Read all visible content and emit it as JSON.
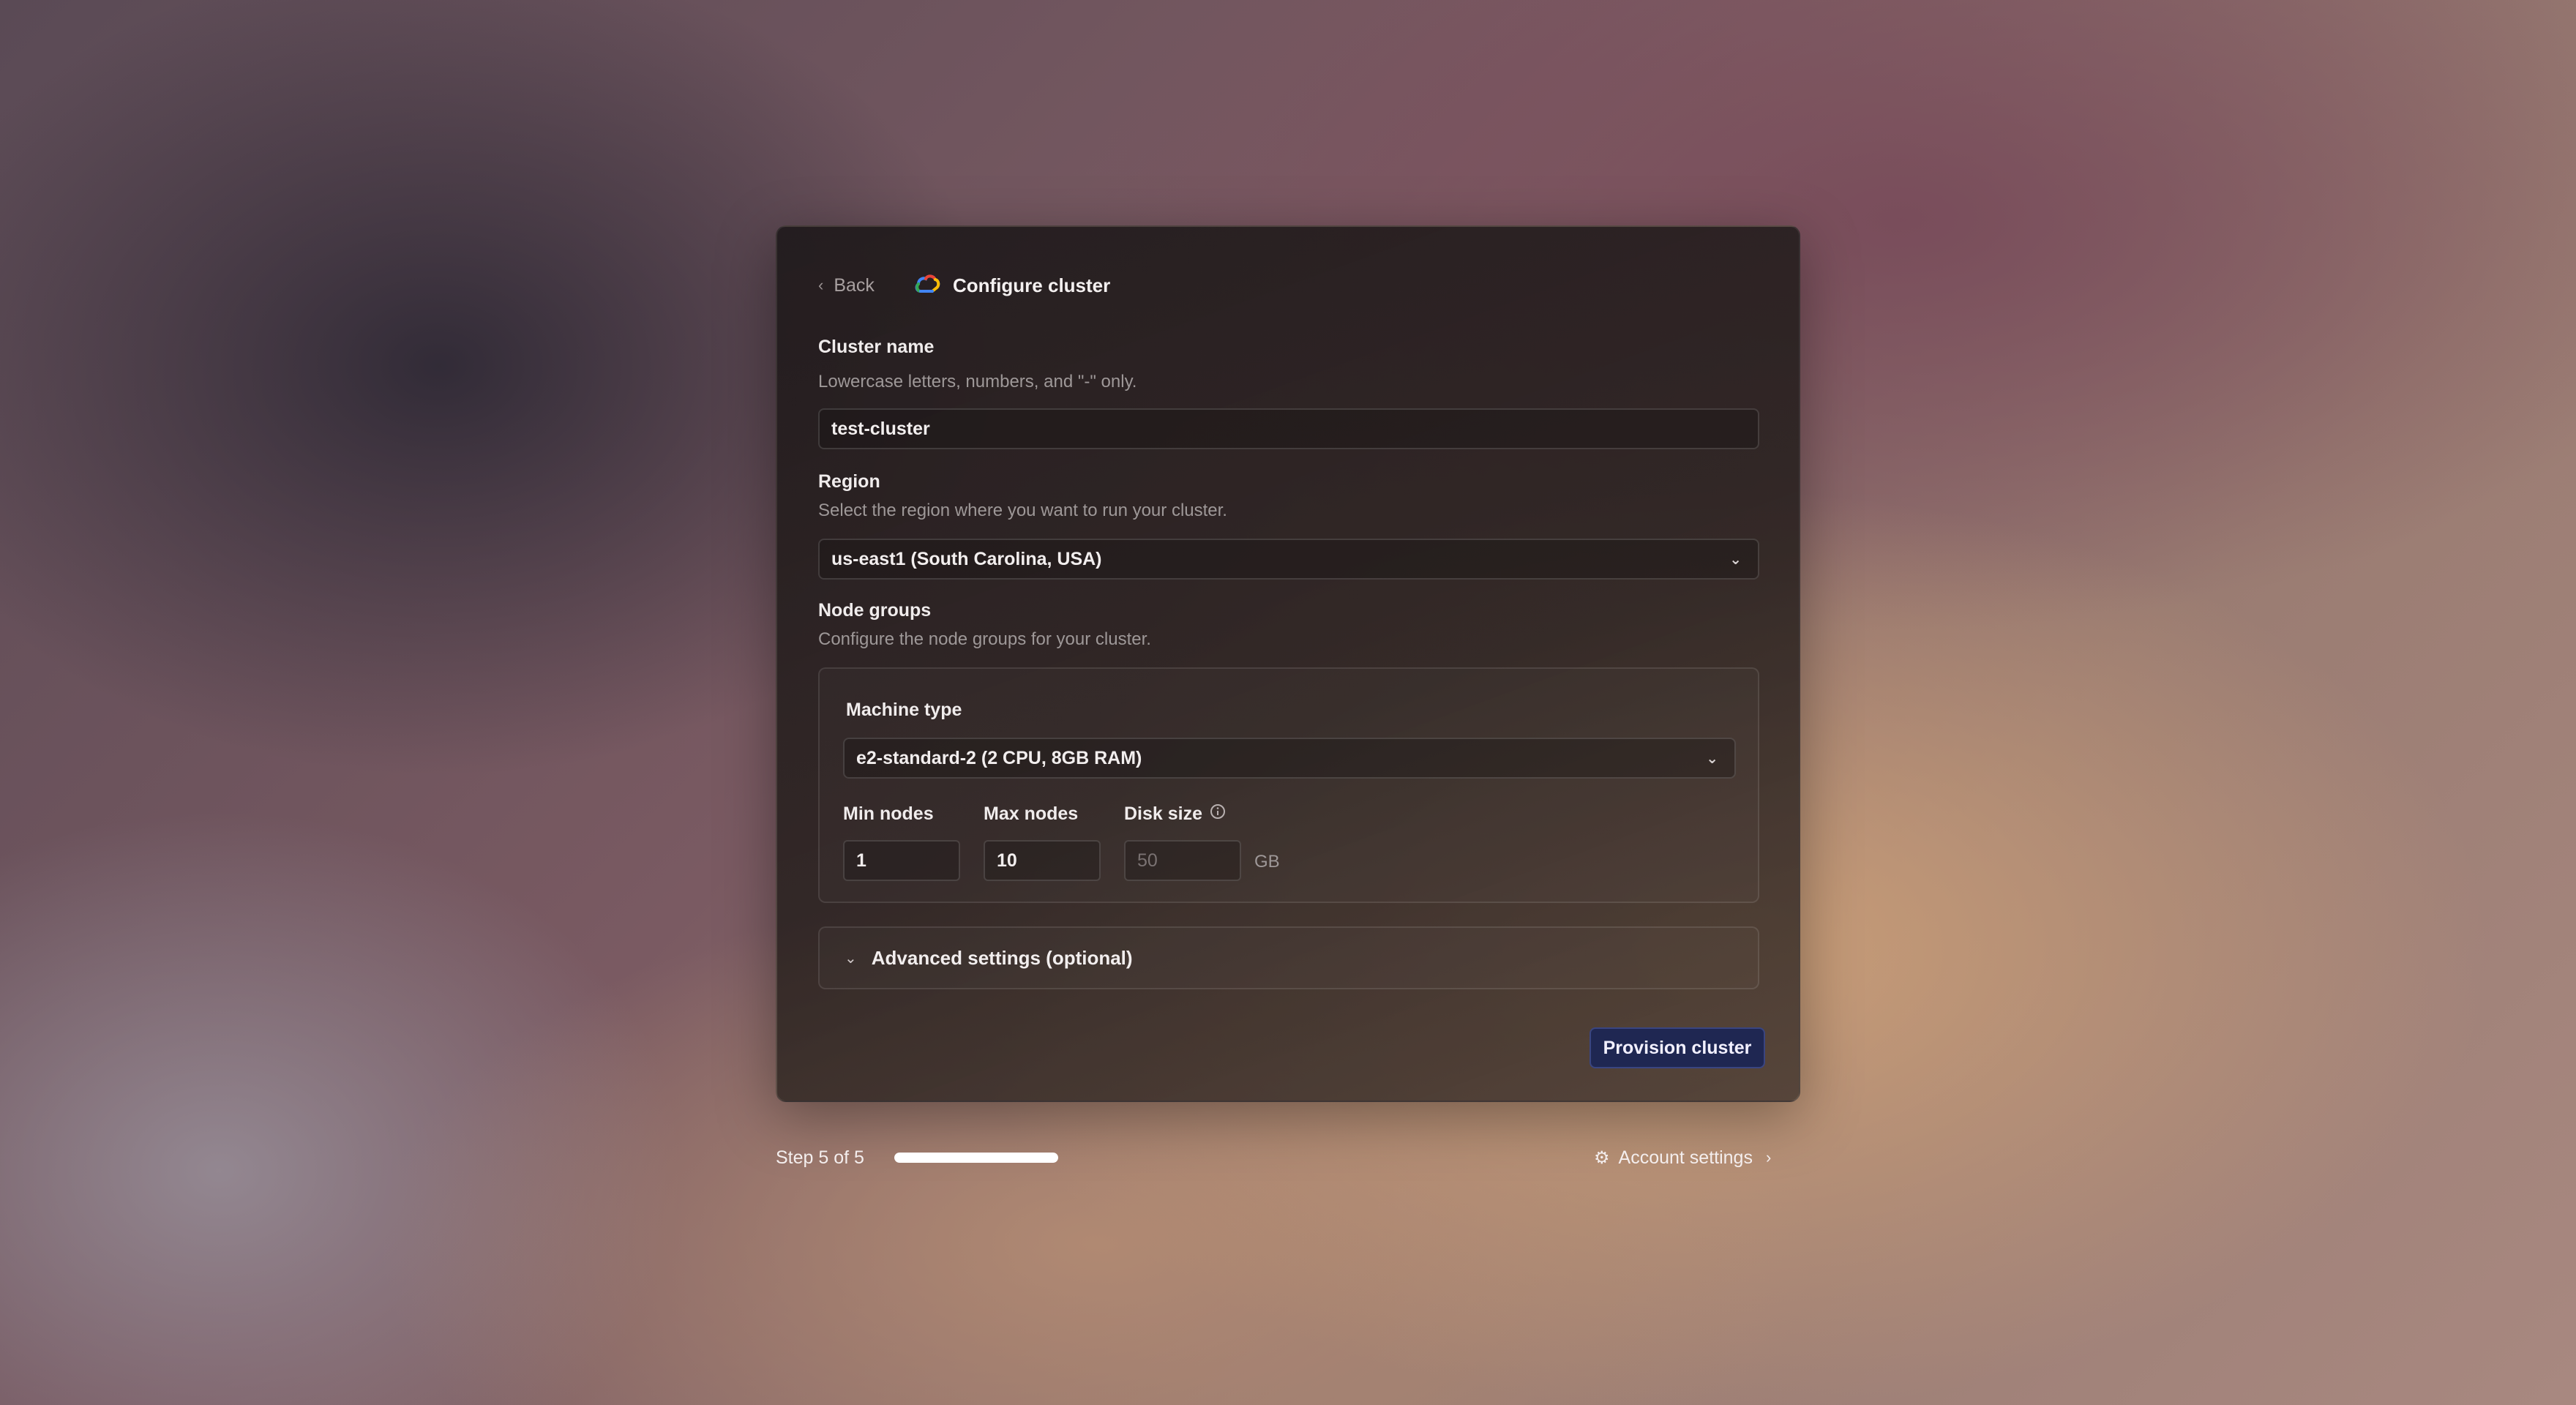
{
  "header": {
    "back_label": "Back",
    "title": "Configure cluster",
    "provider_icon": "google-cloud-icon"
  },
  "cluster_name": {
    "label": "Cluster name",
    "help": "Lowercase letters, numbers, and \"-\" only.",
    "value": "test-cluster"
  },
  "region": {
    "label": "Region",
    "help": "Select the region where you want to run your cluster.",
    "value": "us-east1 (South Carolina, USA)"
  },
  "node_groups": {
    "label": "Node groups",
    "help": "Configure the node groups for your cluster.",
    "machine_type": {
      "label": "Machine type",
      "value": "e2-standard-2 (2 CPU, 8GB RAM)"
    },
    "min_nodes": {
      "label": "Min nodes",
      "value": "1"
    },
    "max_nodes": {
      "label": "Max nodes",
      "value": "10"
    },
    "disk_size": {
      "label": "Disk size",
      "placeholder": "50",
      "unit": "GB"
    }
  },
  "advanced": {
    "label": "Advanced settings (optional)"
  },
  "actions": {
    "provision_label": "Provision cluster"
  },
  "footer": {
    "step_label": "Step 5 of 5",
    "progress_fraction": 1.0,
    "account_label": "Account settings"
  },
  "colors": {
    "primary_button": "#1f2752",
    "accent_progress": "#ffffff"
  }
}
